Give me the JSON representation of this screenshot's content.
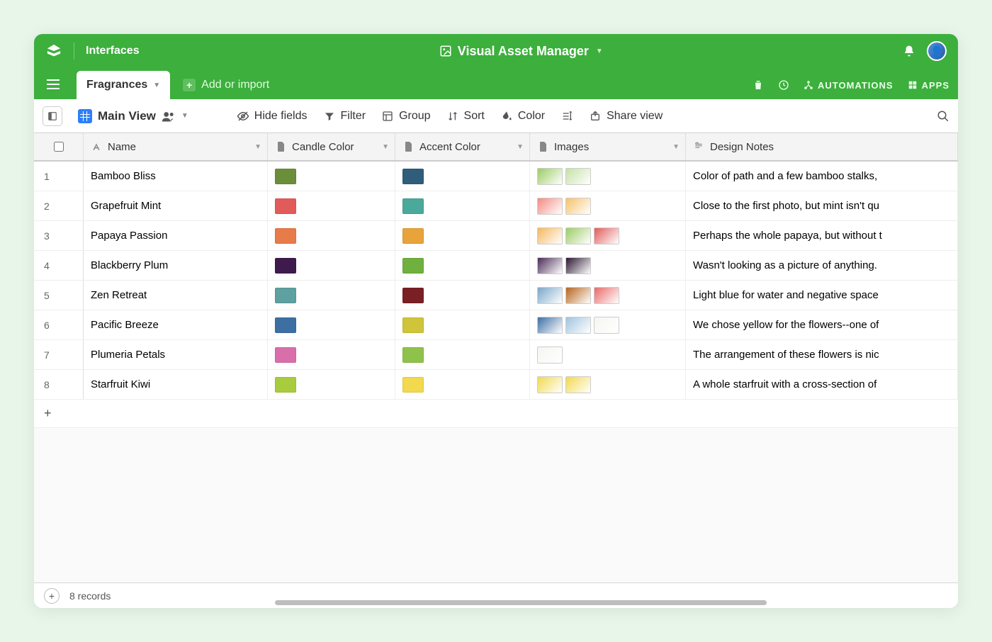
{
  "header": {
    "interfaces": "Interfaces",
    "title": "Visual Asset Manager"
  },
  "tabs": {
    "active": "Fragrances",
    "addOrImport": "Add or import",
    "automations": "AUTOMATIONS",
    "apps": "APPS"
  },
  "toolbar": {
    "view": "Main View",
    "hideFields": "Hide fields",
    "filter": "Filter",
    "group": "Group",
    "sort": "Sort",
    "color": "Color",
    "share": "Share view"
  },
  "columns": {
    "name": "Name",
    "candleColor": "Candle Color",
    "accentColor": "Accent Color",
    "images": "Images",
    "designNotes": "Design Notes"
  },
  "rows": [
    {
      "num": "1",
      "name": "Bamboo Bliss",
      "candle": "#6b8e3b",
      "accent": "#2f5d7a",
      "thumbs": [
        "#9ccc65",
        "#c5e1a5"
      ],
      "notes": "Color of path and a few bamboo stalks,"
    },
    {
      "num": "2",
      "name": "Grapefruit Mint",
      "candle": "#e25b5b",
      "accent": "#4aa99a",
      "thumbs": [
        "#f28b82",
        "#f6c26b"
      ],
      "notes": "Close to the first photo, but mint isn't qu"
    },
    {
      "num": "3",
      "name": "Papaya Passion",
      "candle": "#e87b4a",
      "accent": "#e8a33a",
      "thumbs": [
        "#f4b860",
        "#9ccc65",
        "#e25b5b"
      ],
      "notes": "Perhaps the whole papaya, but without t"
    },
    {
      "num": "4",
      "name": "Blackberry Plum",
      "candle": "#3f1a4d",
      "accent": "#6fb03e",
      "thumbs": [
        "#4a2b57",
        "#2b1632"
      ],
      "notes": "Wasn't looking as a picture of anything."
    },
    {
      "num": "5",
      "name": "Zen Retreat",
      "candle": "#5fa0a0",
      "accent": "#7a1f24",
      "thumbs": [
        "#7aa7c7",
        "#b5651d",
        "#e86a6a"
      ],
      "notes": "Light blue for water and negative space"
    },
    {
      "num": "6",
      "name": "Pacific Breeze",
      "candle": "#3e6fa3",
      "accent": "#cfc43a",
      "thumbs": [
        "#3e6fa3",
        "#a0c4de",
        "#f5f5f0"
      ],
      "notes": "We chose yellow for the flowers--one of"
    },
    {
      "num": "7",
      "name": "Plumeria Petals",
      "candle": "#d86fab",
      "accent": "#8fc24a",
      "thumbs": [
        "#f5f5f0"
      ],
      "notes": "The arrangement of these flowers is nic"
    },
    {
      "num": "8",
      "name": "Starfruit Kiwi",
      "candle": "#a8cc3e",
      "accent": "#f2d94e",
      "thumbs": [
        "#f2d94e",
        "#f2d94e"
      ],
      "notes": "A whole starfruit with a cross-section of"
    }
  ],
  "footer": {
    "count": "8 records"
  }
}
